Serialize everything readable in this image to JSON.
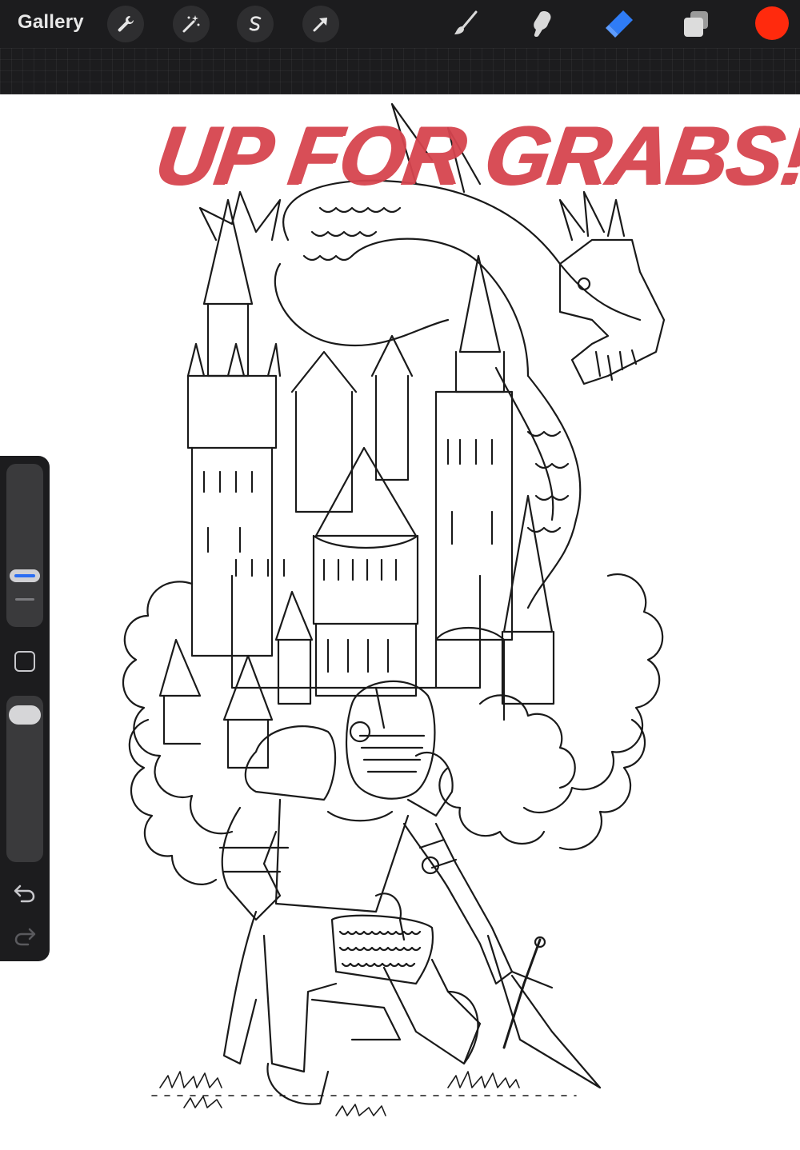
{
  "toolbar": {
    "gallery_label": "Gallery",
    "left_buttons": [
      "wrench-icon",
      "magic-wand-icon",
      "selection-icon",
      "transform-arrow-icon"
    ],
    "right_tools": [
      "brush-icon",
      "smudge-icon",
      "eraser-icon",
      "layers-icon"
    ],
    "active_tool": "eraser",
    "active_tool_color": "#2f7cf6",
    "current_color": "#ff2a0d"
  },
  "sidebar": {
    "controls": [
      "brush-size-slider",
      "modify-button",
      "opacity-slider",
      "undo-button",
      "redo-button"
    ]
  },
  "canvas": {
    "overlay_text": "UP FOR GRABS!",
    "overlay_color": "#d6454f",
    "artwork": "line-art-coloring-page"
  }
}
